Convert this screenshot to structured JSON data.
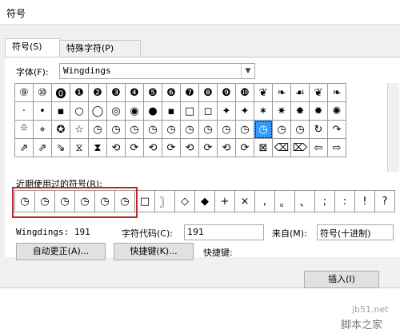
{
  "window": {
    "title": "符号"
  },
  "tabs": [
    {
      "label": "符号(S)"
    },
    {
      "label": "特殊字符(P)"
    }
  ],
  "font": {
    "label": "字体(F):",
    "value": "Wingdings"
  },
  "symbol_grid": {
    "rows": [
      [
        "⑨",
        "⑩",
        "⓿",
        "❶",
        "❷",
        "❸",
        "❹",
        "❺",
        "❻",
        "❼",
        "❽",
        "❾",
        "❿",
        "❦",
        "❧",
        "☙",
        "❦",
        "❧"
      ],
      [
        "·",
        "•",
        "▪",
        "○",
        "◯",
        "◎",
        "◉",
        "●",
        "▪",
        "□",
        "◻",
        "✦",
        "✦",
        "✶",
        "✷",
        "✸",
        "✹",
        "✺"
      ],
      [
        "⯐",
        "⌖",
        "✪",
        "☆",
        "◷",
        "◷",
        "◷",
        "◷",
        "◷",
        "◷",
        "◷",
        "◷",
        "◷",
        "◷",
        "◷",
        "◷",
        "↻",
        "↷"
      ],
      [
        "⇗",
        "⇗",
        "⇘",
        "⧖",
        "⧗",
        "⟲",
        "⟳",
        "⟲",
        "⟳",
        "⟲",
        "⟳",
        "⟲",
        "⟳",
        "⊠",
        "⌫",
        "⌦",
        "⇦",
        "⇨"
      ]
    ]
  },
  "recent": {
    "label": "近期使用过的符号(R):",
    "symbols": [
      "◷",
      "◷",
      "◷",
      "◷",
      "◷",
      "◷",
      "□",
      "〗",
      "◇",
      "◆",
      "+",
      "×",
      ",",
      "。",
      "、",
      ";",
      ":",
      "!",
      "?"
    ]
  },
  "status": {
    "font_code": "Wingdings: 191",
    "char_code_label": "字符代码(C):",
    "char_code_value": "191",
    "from_label": "来自(M):",
    "from_value": "符号(十进制)"
  },
  "buttons": {
    "autocorrect": "自动更正(A)...",
    "shortcut_key": "快捷键(K)...",
    "shortcut_label": "快捷键:",
    "insert": "插入(I)"
  },
  "watermark": {
    "line1": "jb51.net",
    "line2": "脚本之家"
  }
}
